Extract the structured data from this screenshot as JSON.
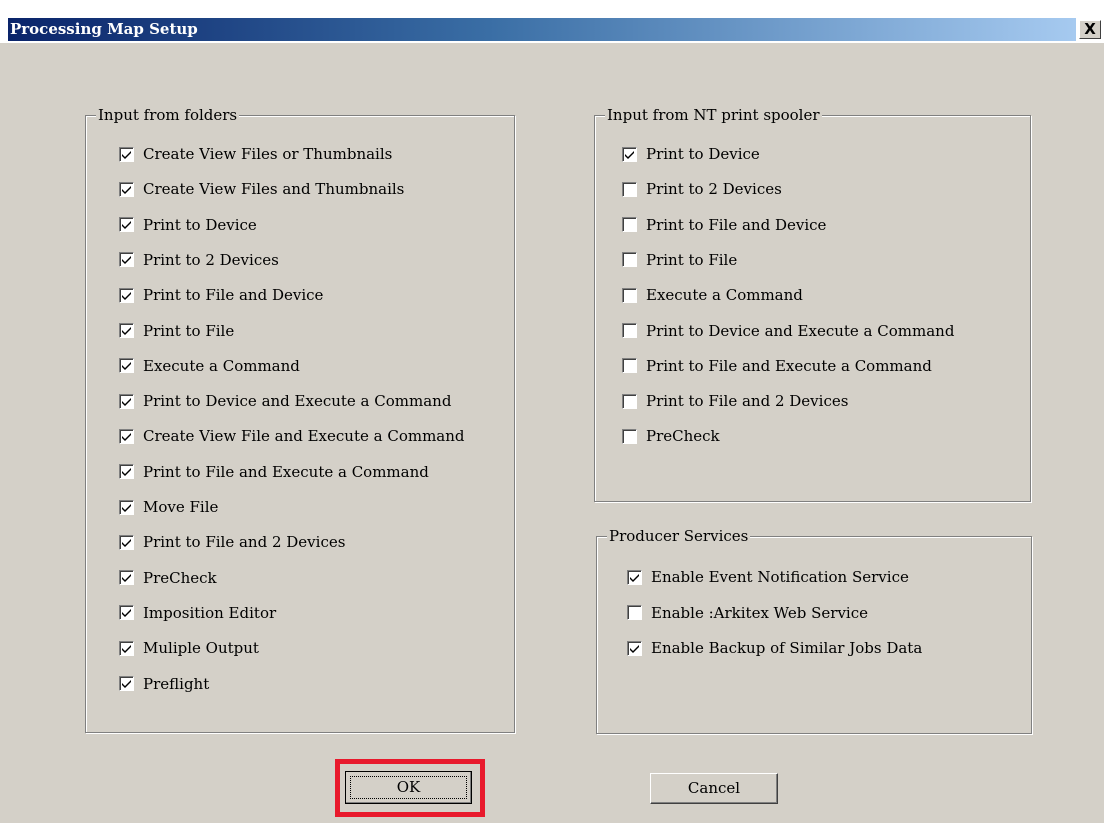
{
  "window": {
    "title": "Processing Map Setup",
    "close_label": "X"
  },
  "folders": {
    "legend": "Input from folders",
    "items": [
      {
        "label": "Create View Files or Thumbnails",
        "checked": true
      },
      {
        "label": "Create View Files and Thumbnails",
        "checked": true
      },
      {
        "label": "Print to Device",
        "checked": true
      },
      {
        "label": "Print to 2 Devices",
        "checked": true
      },
      {
        "label": "Print to File and Device",
        "checked": true
      },
      {
        "label": "Print to File",
        "checked": true
      },
      {
        "label": "Execute a Command",
        "checked": true
      },
      {
        "label": "Print to Device and Execute a Command",
        "checked": true
      },
      {
        "label": "Create View File and Execute a Command",
        "checked": true
      },
      {
        "label": "Print to File and Execute a Command",
        "checked": true
      },
      {
        "label": "Move File",
        "checked": true
      },
      {
        "label": "Print to File and 2 Devices",
        "checked": true
      },
      {
        "label": "PreCheck",
        "checked": true
      },
      {
        "label": "Imposition Editor",
        "checked": true
      },
      {
        "label": "Muliple Output",
        "checked": true
      },
      {
        "label": "Preflight",
        "checked": true
      }
    ]
  },
  "spooler": {
    "legend": "Input from NT print spooler",
    "items": [
      {
        "label": "Print to Device",
        "checked": true
      },
      {
        "label": "Print to 2 Devices",
        "checked": false
      },
      {
        "label": "Print to File and Device",
        "checked": false
      },
      {
        "label": "Print to File",
        "checked": false
      },
      {
        "label": "Execute a Command",
        "checked": false
      },
      {
        "label": "Print to Device and Execute a Command",
        "checked": false
      },
      {
        "label": "Print to File and Execute a Command",
        "checked": false
      },
      {
        "label": "Print to File and 2 Devices",
        "checked": false
      },
      {
        "label": "PreCheck",
        "checked": false
      }
    ]
  },
  "producer": {
    "legend": "Producer Services",
    "items": [
      {
        "label": "Enable Event Notification Service",
        "checked": true
      },
      {
        "label": "Enable :Arkitex Web Service",
        "checked": false
      },
      {
        "label": "Enable Backup of Similar Jobs Data",
        "checked": true
      }
    ]
  },
  "buttons": {
    "ok_label": "OK",
    "cancel_label": "Cancel"
  },
  "highlight_color": "#e8192c"
}
